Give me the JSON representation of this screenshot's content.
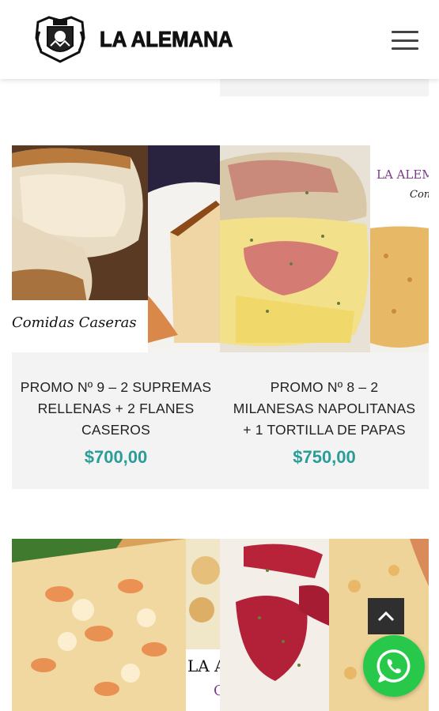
{
  "header": {
    "brand_name": "LA ALEMANA",
    "logo_icon": "crest-logo-icon",
    "menu_icon": "hamburger-menu-icon"
  },
  "products": [
    {
      "title_lines": [
        "PROMO Nº 9 – 2 SUPREMAS",
        "RELLENAS + 2 FLANES",
        "CASEROS"
      ],
      "price": "$700,00",
      "image_caption": "Comidas Caseras"
    },
    {
      "title_lines": [
        "PROMO Nº 8 – 2",
        "MILANESAS NAPOLITANAS",
        "+ 1 TORTILLA DE PAPAS"
      ],
      "price": "$750,00",
      "image_caption_1": "LA ALEM",
      "image_caption_2": "Con"
    },
    {
      "image_caption_1": "LA A",
      "image_caption_2": "C"
    },
    {}
  ],
  "floating": {
    "scroll_top_icon": "chevron-up-icon",
    "whatsapp_icon": "whatsapp-icon"
  },
  "colors": {
    "price": "#2a9d98",
    "card_bg": "#f3f3f3",
    "whatsapp": "#28c94a"
  }
}
